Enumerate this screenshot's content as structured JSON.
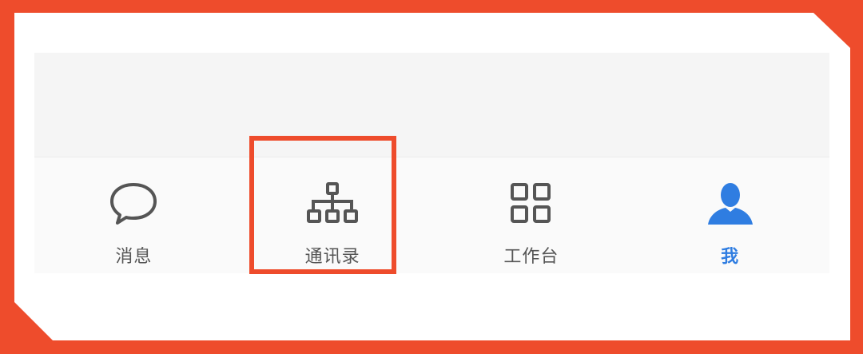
{
  "tabbar": {
    "tabs": [
      {
        "label": "消息",
        "icon": "chat-bubble-icon",
        "active": false
      },
      {
        "label": "通讯录",
        "icon": "org-chart-icon",
        "active": false
      },
      {
        "label": "工作台",
        "icon": "grid-icon",
        "active": false
      },
      {
        "label": "我",
        "icon": "person-icon",
        "active": true
      }
    ]
  },
  "colors": {
    "accent_border": "#ee4c2c",
    "active_tab": "#2f7de1",
    "inactive_tab": "#555555"
  },
  "highlighted_tab": "通讯录"
}
